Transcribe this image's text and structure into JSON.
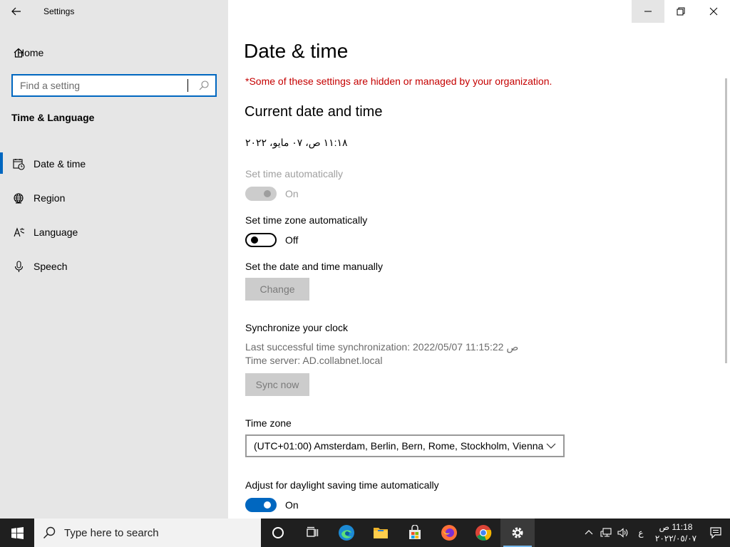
{
  "window": {
    "app_title": "Settings",
    "controls": [
      "minimize",
      "restore",
      "close"
    ]
  },
  "sidebar": {
    "home_label": "Home",
    "search_placeholder": "Find a setting",
    "section_title": "Time & Language",
    "items": [
      {
        "label": "Date & time",
        "icon": "calendar-clock-icon",
        "active": true
      },
      {
        "label": "Region",
        "icon": "globe-icon",
        "active": false
      },
      {
        "label": "Language",
        "icon": "language-icon",
        "active": false
      },
      {
        "label": "Speech",
        "icon": "microphone-icon",
        "active": false
      }
    ]
  },
  "main": {
    "title": "Date & time",
    "managed_notice": "*Some of these settings are hidden or managed by your organization.",
    "section_title": "Current date and time",
    "current_datetime": "١١:١٨ ص، ٠٧ مايو، ٢٠٢٢",
    "set_time_auto": {
      "label": "Set time automatically",
      "state": "On",
      "enabled": false
    },
    "set_tz_auto": {
      "label": "Set time zone automatically",
      "state": "Off",
      "enabled": true
    },
    "manual": {
      "label": "Set the date and time manually",
      "button": "Change"
    },
    "sync": {
      "title": "Synchronize your clock",
      "last_sync": "Last successful time synchronization: ص 11:15:22 2022/05/07",
      "server": "Time server: AD.collabnet.local",
      "button": "Sync now"
    },
    "timezone": {
      "label": "Time zone",
      "value": "(UTC+01:00) Amsterdam, Berlin, Bern, Rome, Stockholm, Vienna"
    },
    "dst": {
      "label": "Adjust for daylight saving time automatically",
      "state": "On"
    }
  },
  "taskbar": {
    "search_text": "Type here to search",
    "apps": [
      "task-view",
      "edge",
      "file-explorer",
      "store",
      "firefox",
      "chrome",
      "settings"
    ],
    "lang": "ع",
    "time": "11:18 ص",
    "date": "٢٠٢٢/٠٥/٠٧",
    "accent": "#0067c0"
  }
}
